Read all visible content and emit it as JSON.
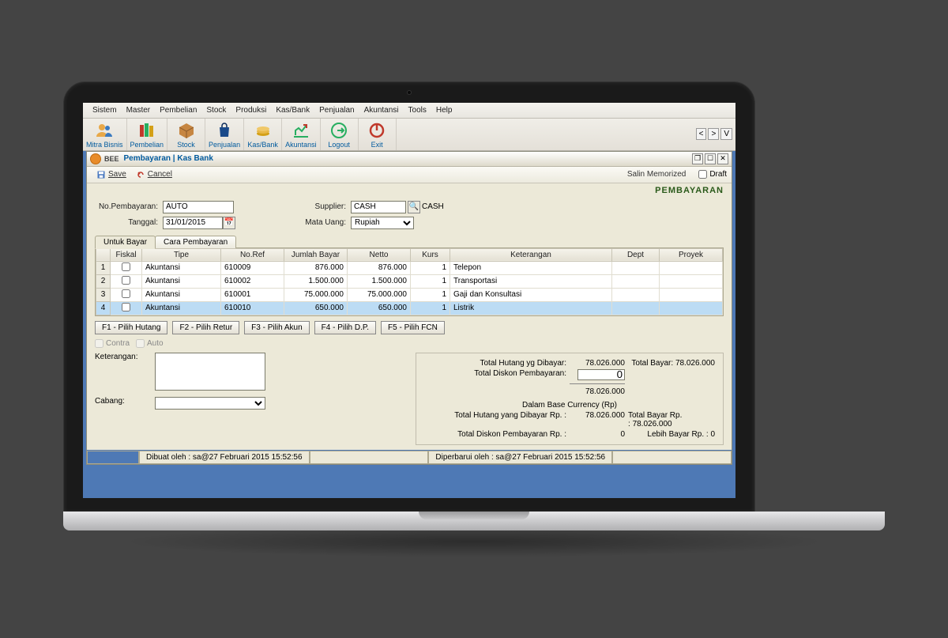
{
  "menus": [
    "Sistem",
    "Master",
    "Pembelian",
    "Stock",
    "Produksi",
    "Kas/Bank",
    "Penjualan",
    "Akuntansi",
    "Tools",
    "Help"
  ],
  "toolbar": [
    "Mitra Bisnis",
    "Pembelian",
    "Stock",
    "Penjualan",
    "Kas/Bank",
    "Akuntansi",
    "Logout",
    "Exit"
  ],
  "nav": {
    "prev": "<",
    "next": ">",
    "v": "V"
  },
  "window": {
    "brand": "BEE",
    "title": "Pembayaran | Kas Bank"
  },
  "actions": {
    "save": "Save",
    "cancel": "Cancel",
    "salin": "Salin Memorized",
    "draft": "Draft"
  },
  "module_title": "PEMBAYARAN",
  "form": {
    "no_pembayaran_label": "No.Pembayaran:",
    "no_pembayaran": "AUTO",
    "tanggal_label": "Tanggal:",
    "tanggal": "31/01/2015",
    "supplier_label": "Supplier:",
    "supplier": "CASH",
    "supplier_name": "CASH",
    "mata_uang_label": "Mata Uang:",
    "mata_uang": "Rupiah"
  },
  "tabs": {
    "bayar": "Untuk Bayar",
    "cara": "Cara Pembayaran"
  },
  "grid": {
    "headers": [
      "",
      "Fiskal",
      "Tipe",
      "No.Ref",
      "Jumlah Bayar",
      "Netto",
      "Kurs",
      "Keterangan",
      "Dept",
      "Proyek"
    ],
    "rows": [
      {
        "n": "1",
        "tipe": "Akuntansi",
        "ref": "610009",
        "bayar": "876.000",
        "netto": "876.000",
        "kurs": "1",
        "ket": "Telepon"
      },
      {
        "n": "2",
        "tipe": "Akuntansi",
        "ref": "610002",
        "bayar": "1.500.000",
        "netto": "1.500.000",
        "kurs": "1",
        "ket": "Transportasi"
      },
      {
        "n": "3",
        "tipe": "Akuntansi",
        "ref": "610001",
        "bayar": "75.000.000",
        "netto": "75.000.000",
        "kurs": "1",
        "ket": "Gaji dan Konsultasi"
      },
      {
        "n": "4",
        "tipe": "Akuntansi",
        "ref": "610010",
        "bayar": "650.000",
        "netto": "650.000",
        "kurs": "1",
        "ket": "Listrik"
      }
    ]
  },
  "buttons": {
    "f1": "F1 - Pilih Hutang",
    "f2": "F2 - Pilih Retur",
    "f3": "F3 - Pilih Akun",
    "f4": "F4 - Pilih D.P.",
    "f5": "F5 - Pilih FCN"
  },
  "contra": {
    "contra": "Contra",
    "auto": "Auto"
  },
  "left": {
    "ket_label": "Keterangan:",
    "cabang_label": "Cabang:"
  },
  "summary": {
    "l_total_hutang": "Total Hutang yg Dibayar:",
    "v_total_hutang": "78.026.000",
    "l_total_bayar": "Total Bayar:",
    "v_total_bayar": "78.026.000",
    "l_diskon": "Total Diskon Pembayaran:",
    "v_diskon": "0",
    "v_subtotal": "78.026.000",
    "l_base": "Dalam Base Currency (Rp)",
    "l_hutang_rp": "Total Hutang yang Dibayar Rp. :",
    "v_hutang_rp": "78.026.000",
    "l_bayar_rp": "Total Bayar Rp. :",
    "v_bayar_rp": "78.026.000",
    "l_diskon_rp": "Total Diskon Pembayaran Rp. :",
    "v_diskon_rp": "0",
    "l_lebih": "Lebih Bayar Rp. :",
    "v_lebih": "0"
  },
  "status": {
    "created": "Dibuat oleh : sa@27 Februari 2015  15:52:56",
    "updated": "Diperbarui oleh : sa@27 Februari 2015  15:52:56"
  }
}
